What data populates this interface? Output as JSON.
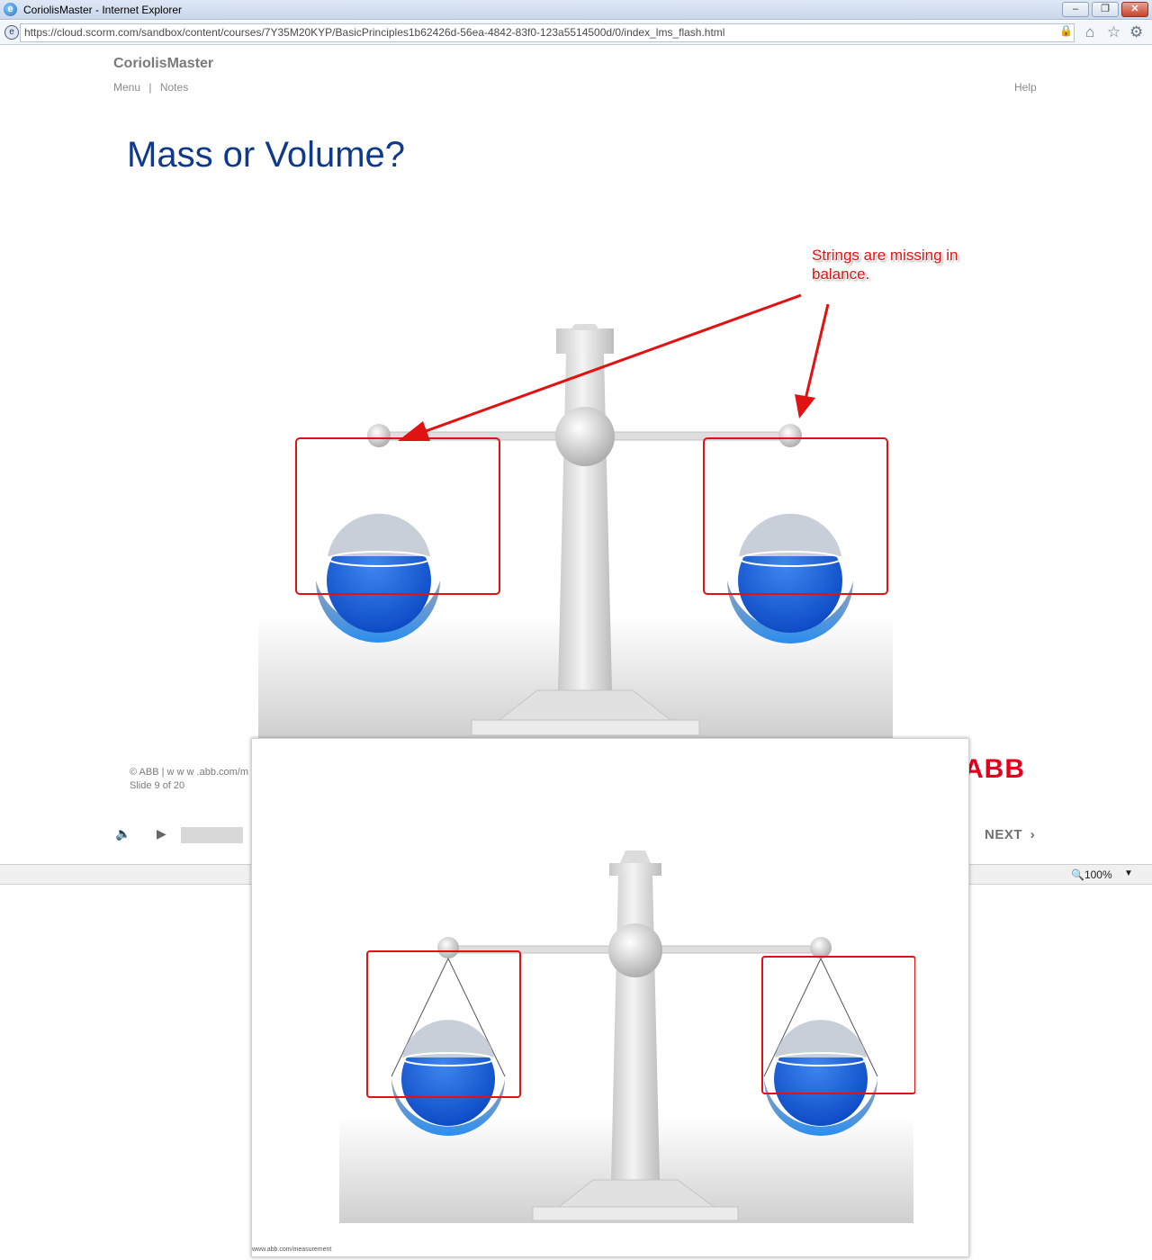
{
  "browser": {
    "window_title": "CoriolisMaster - Internet Explorer",
    "url": "https://cloud.scorm.com/sandbox/content/courses/7Y35M20KYP/BasicPrinciples1b62426d-56ea-4842-83f0-123a5514500d/0/index_lms_flash.html",
    "zoom": "100%"
  },
  "app": {
    "title": "CoriolisMaster",
    "nav": [
      "Menu",
      "Notes"
    ],
    "nav_separator": "|",
    "help": "Help"
  },
  "slide": {
    "title": "Mass or Volume?",
    "footer_copyright": "© ABB | w w w .abb.com/m",
    "footer_slide": "Slide 9 of 20",
    "logo": "ABB"
  },
  "annotation": {
    "text": "Strings are missing in balance."
  },
  "player": {
    "next": "NEXT"
  },
  "overlay": {
    "footer_url": "www.abb.com/measurement"
  },
  "colors": {
    "title_blue": "#0f3a8a",
    "annotation_red": "#e01212",
    "abb_red": "#e2001a",
    "fluid_blue": "#1560d8"
  },
  "icons": {
    "ie": "ie-logo-icon",
    "site": "site-icon",
    "lock": "lock-icon",
    "home": "home-icon",
    "favorites": "star-icon",
    "tools": "gear-icon",
    "audio": "speaker-icon",
    "play": "play-icon",
    "next": "chevron-right-icon",
    "zoom": "magnifier-icon"
  }
}
